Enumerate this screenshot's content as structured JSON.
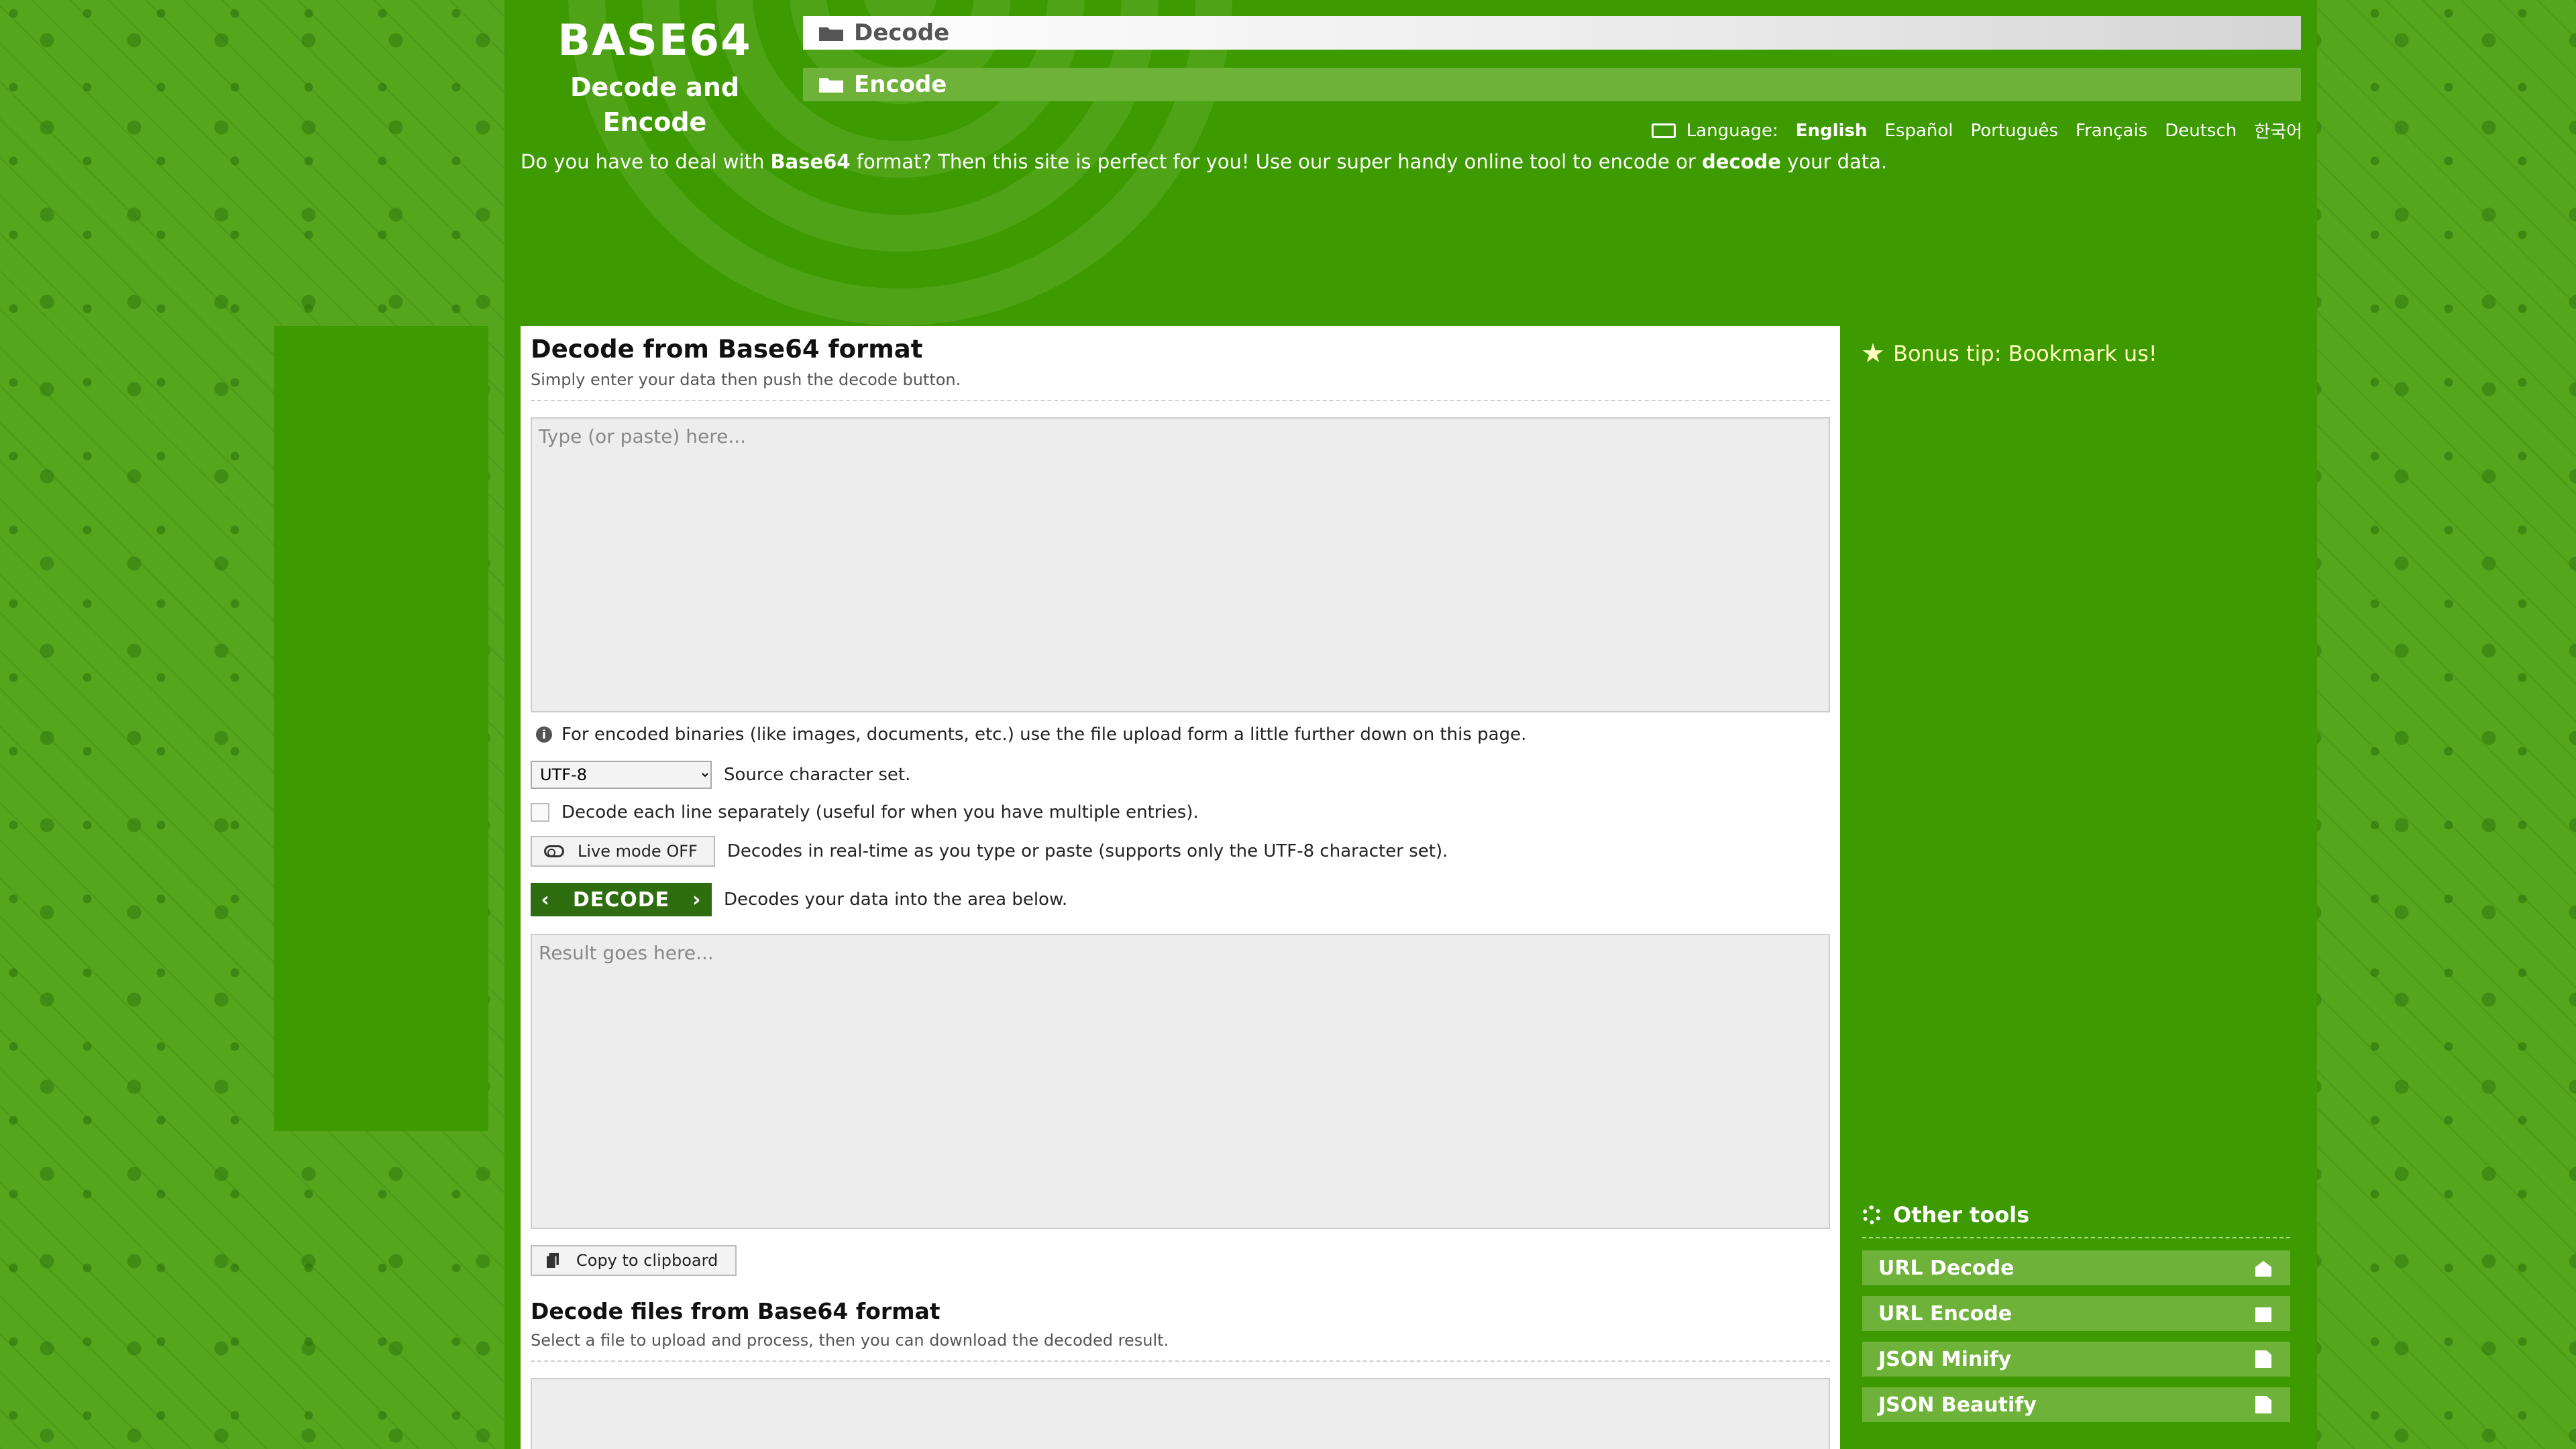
{
  "header": {
    "brand_title": "BASE64",
    "brand_subtitle": "Decode and Encode",
    "nav": [
      {
        "label": "Decode",
        "icon": "folder-open-icon",
        "active": true
      },
      {
        "label": "Encode",
        "icon": "folder-icon",
        "active": false
      }
    ],
    "language_label": "Language:",
    "languages": [
      "English",
      "Español",
      "Português",
      "Français",
      "Deutsch",
      "한국어"
    ],
    "selected_language": "English",
    "intro": {
      "p1": "Do you have to deal with ",
      "b1": "Base64",
      "p2": " format? Then this site is perfect for you! Use our super handy online tool to encode or ",
      "b2": "decode",
      "p3": " your data."
    }
  },
  "decode_panel": {
    "title": "Decode from Base64 format",
    "subtitle": "Simply enter your data then push the decode button.",
    "input_placeholder": "Type (or paste) here...",
    "input_value": "",
    "info_note": "For encoded binaries (like images, documents, etc.) use the file upload form a little further down on this page.",
    "charset_value": "UTF-8",
    "charset_label": "Source character set.",
    "each_line_label": "Decode each line separately (useful for when you have multiple entries).",
    "each_line_checked": false,
    "live_mode_button": "Live mode OFF",
    "live_mode_description": "Decodes in real-time as you type or paste (supports only the UTF-8 character set).",
    "decode_button": "DECODE",
    "decode_description": "Decodes your data into the area below.",
    "result_placeholder": "Result goes here...",
    "copy_button": "Copy to clipboard"
  },
  "file_panel": {
    "title": "Decode files from Base64 format",
    "subtitle": "Select a file to upload and process, then you can download the decoded result."
  },
  "sidebar": {
    "bonus_tip": "Bonus tip: Bookmark us!",
    "other_tools_title": "Other tools",
    "tools": [
      {
        "label": "URL Decode",
        "icon": "envelope-open-icon"
      },
      {
        "label": "URL Encode",
        "icon": "envelope-icon"
      },
      {
        "label": "JSON Minify",
        "icon": "file-icon"
      },
      {
        "label": "JSON Beautify",
        "icon": "file-icon"
      }
    ]
  },
  "colors": {
    "page_background": "#56a61d",
    "site_green": "#3d9a00",
    "menu_item_green": "#6fb23a",
    "decode_button": "#2e6e10",
    "bonus_tip_text": "#ffffbf"
  }
}
